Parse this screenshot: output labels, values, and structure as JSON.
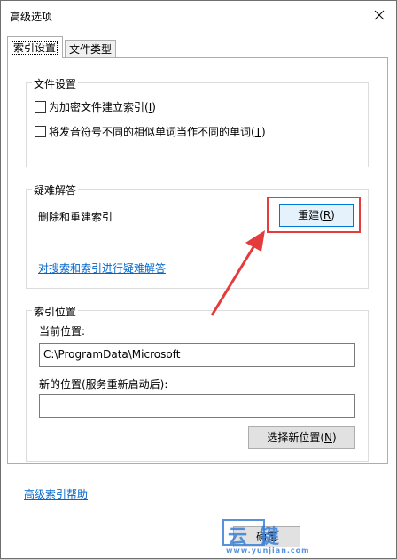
{
  "window": {
    "title": "高级选项"
  },
  "tabs": [
    {
      "label": "索引设置"
    },
    {
      "label": "文件类型"
    }
  ],
  "file_settings": {
    "legend": "文件设置",
    "encrypt_label": "为加密文件建立索引(",
    "encrypt_key": "I",
    "diacritics_label": "将发音符号不同的相似单词当作不同的单词(",
    "diacritics_key": "T"
  },
  "troubleshoot": {
    "legend": "疑难解答",
    "rebuild_text": "删除和重建索引",
    "rebuild_button": "重建(",
    "rebuild_key": "R",
    "link": "对搜索和索引进行疑难解答"
  },
  "index_location": {
    "legend": "索引位置",
    "current_label": "当前位置:",
    "current_value": "C:\\ProgramData\\Microsoft",
    "new_label": "新的位置(服务重新启动后):",
    "new_value": "",
    "select_button": "选择新位置(",
    "select_key": "N"
  },
  "help_link": "高级索引帮助",
  "ok_button": "确定",
  "watermark": {
    "big": "云键",
    "small": "www.yunjian.com"
  },
  "colors": {
    "highlight": "#e43c3c",
    "arrow": "#e43c3c",
    "link": "#0066cc",
    "primary_border": "#0078d7"
  }
}
